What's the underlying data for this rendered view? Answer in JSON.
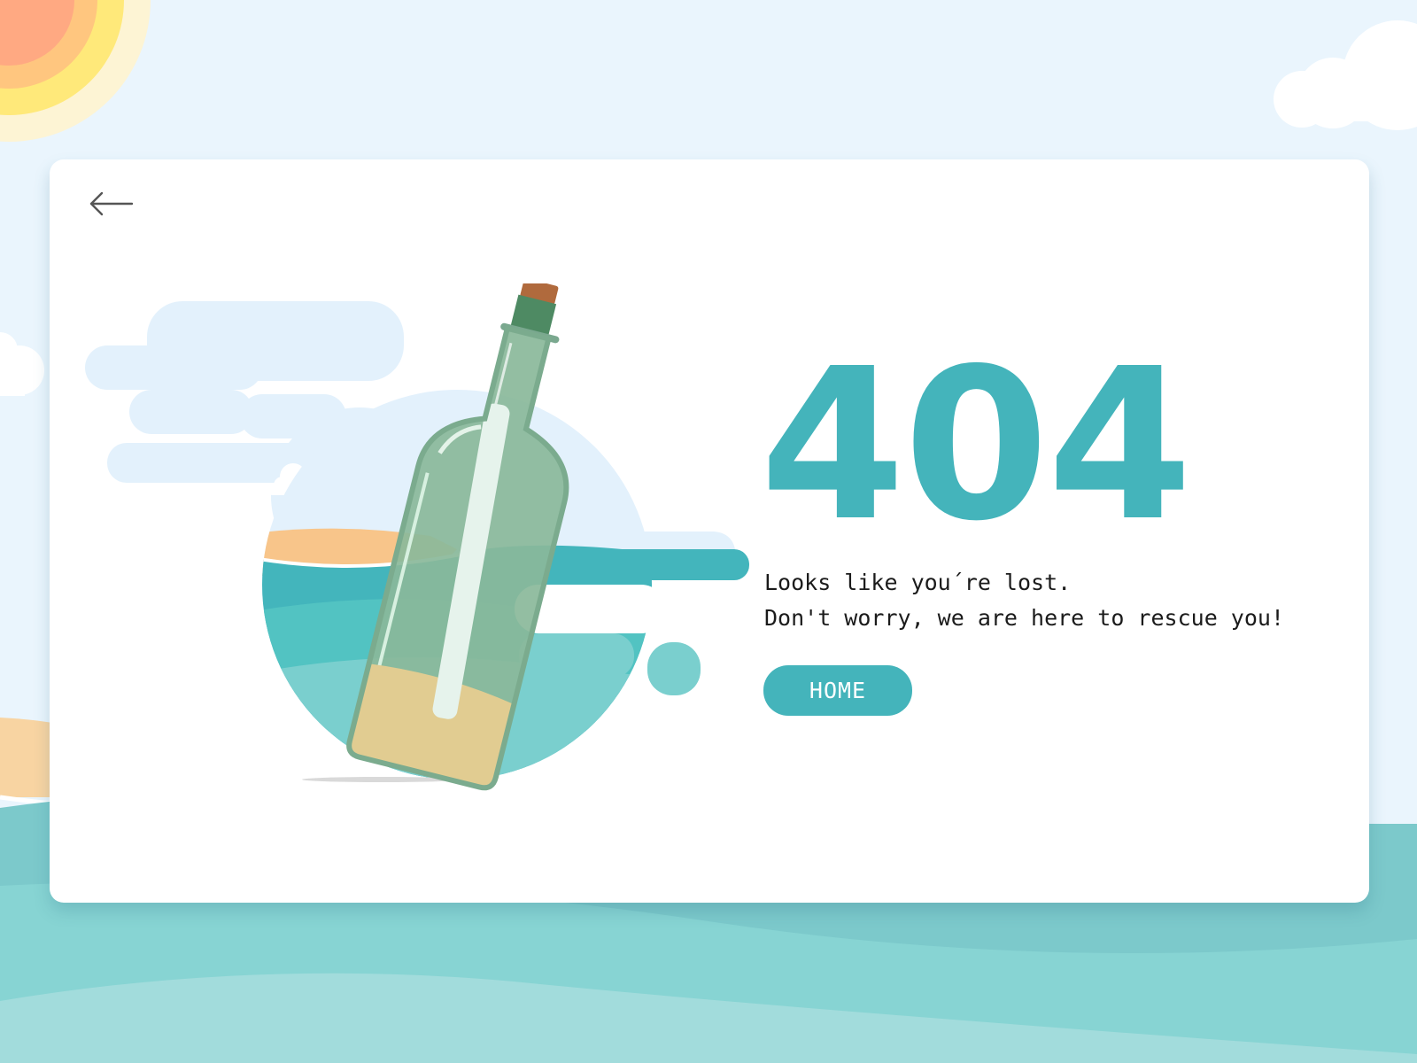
{
  "page": {
    "error_code": "404",
    "message_line_1": "Looks like you´re lost.",
    "message_line_2": "Don't worry, we are here to rescue you!",
    "home_button_label": "HOME"
  },
  "icons": {
    "back": "arrow-left-icon",
    "illustration": "message-in-a-bottle"
  },
  "colors": {
    "accent": "#44b4bb",
    "sky": "#eaf5fd",
    "sea": "#7fd1d2",
    "sand": "#f7c98d",
    "sun": "#ffe97a",
    "bottle": "#5e9e7c",
    "cork": "#b06a3d",
    "card": "#ffffff",
    "text": "#1b1b1b"
  }
}
